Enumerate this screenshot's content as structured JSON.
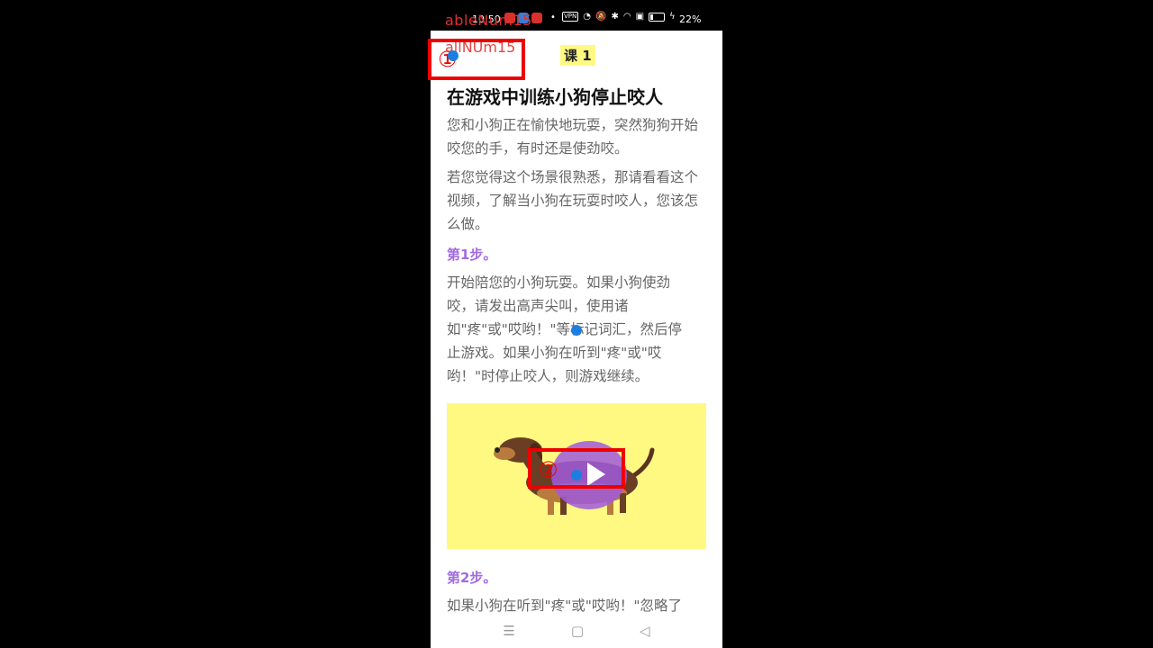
{
  "statusbar": {
    "time": "10:50",
    "battery_percent": "22%",
    "vpn_label": "VPN"
  },
  "overlay": {
    "text1": "ableNum15",
    "text2": "allNUm15",
    "marker1": "①",
    "marker2": "②"
  },
  "header": {
    "lesson_tag": "课 1"
  },
  "article": {
    "title": "在游戏中训练小狗停止咬人",
    "intro_1": "您和小狗正在愉快地玩耍，突然狗狗开始咬您的手，有时还是使劲咬。",
    "intro_2": "若您觉得这个场景很熟悉，那请看看这个视频，了解当小狗在玩耍时咬人，您该怎么做。",
    "step1_label": "第1步。",
    "step1_text": "开始陪您的小狗玩耍。如果小狗使劲咬，请发出高声尖叫，使用诸如\"疼\"或\"哎哟！\"等标记词汇，然后停止游戏。如果小狗在听到\"疼\"或\"哎哟！\"时停止咬人，则游戏继续。",
    "step2_label": "第2步。",
    "step2_text": "如果小狗在听到\"疼\"或\"哎哟！\"忽略了"
  },
  "navbar": {
    "menu_icon": "☰",
    "home_icon": "▢",
    "back_icon": "◁"
  },
  "colors": {
    "accent_step": "#a26be0",
    "video_bg": "#fff982",
    "annotation_red": "#e00000",
    "touch_dot": "#1a7fe0"
  }
}
